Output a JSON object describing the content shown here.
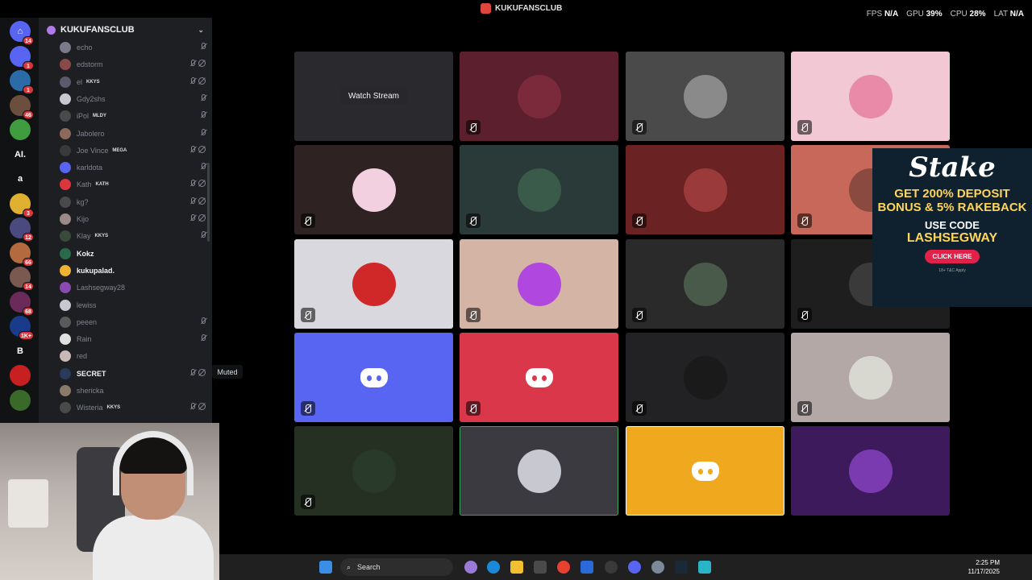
{
  "window": {
    "title": "KUKUFANSCLUB"
  },
  "stats": [
    {
      "label": "FPS",
      "value": "N/A"
    },
    {
      "label": "GPU",
      "value": "39%"
    },
    {
      "label": "CPU",
      "value": "28%"
    },
    {
      "label": "LAT",
      "value": "N/A"
    }
  ],
  "servers": [
    {
      "name": "discord-home",
      "badge": "14",
      "color": "#5865f2",
      "glyph": "⌂"
    },
    {
      "name": "server-2",
      "badge": "1",
      "color": "#5865f2",
      "glyph": ""
    },
    {
      "name": "server-3",
      "badge": "1",
      "color": "#2b6ca8",
      "glyph": ""
    },
    {
      "name": "server-4",
      "badge": "46",
      "color": "#6c4e3e",
      "glyph": ""
    },
    {
      "name": "server-5",
      "badge": "",
      "color": "#3f9d3f",
      "glyph": ""
    },
    {
      "name": "server-ai",
      "badge": "",
      "color": "#111214",
      "glyph": "AI."
    },
    {
      "name": "server-a",
      "badge": "",
      "color": "#111214",
      "glyph": "a"
    },
    {
      "name": "server-8",
      "badge": "3",
      "color": "#e0b030",
      "glyph": ""
    },
    {
      "name": "server-9",
      "badge": "12",
      "color": "#4a4a80",
      "glyph": ""
    },
    {
      "name": "server-10",
      "badge": "66",
      "color": "#b26a3e",
      "glyph": ""
    },
    {
      "name": "server-11",
      "badge": "14",
      "color": "#7a5a50",
      "glyph": ""
    },
    {
      "name": "server-12",
      "badge": "68",
      "color": "#6a2a5a",
      "glyph": ""
    },
    {
      "name": "server-13",
      "badge": "1K+",
      "color": "#1a3a8a",
      "glyph": ""
    },
    {
      "name": "server-b",
      "badge": "",
      "color": "#111214",
      "glyph": "B"
    },
    {
      "name": "server-15",
      "badge": "",
      "color": "#c82020",
      "glyph": ""
    },
    {
      "name": "server-16",
      "badge": "",
      "color": "#3a6a2a",
      "glyph": ""
    }
  ],
  "sidebar": {
    "server_name": "KUKUFANSCLUB"
  },
  "members": [
    {
      "name": "echo",
      "tag": "",
      "bright": false,
      "color": "#7a7a8a",
      "icons": 1
    },
    {
      "name": "edstorm",
      "tag": "",
      "bright": false,
      "color": "#8a4a4a",
      "icons": 2
    },
    {
      "name": "el",
      "tag": "KKYS",
      "bright": false,
      "color": "#5a5a6a",
      "icons": 2
    },
    {
      "name": "Gdy2shs",
      "tag": "",
      "bright": false,
      "color": "#c8c8d0",
      "icons": 1
    },
    {
      "name": "iPol",
      "tag": "MLDY",
      "bright": false,
      "color": "#4a4a4a",
      "icons": 1
    },
    {
      "name": "Jabolero",
      "tag": "",
      "bright": false,
      "color": "#8a6a5a",
      "icons": 1
    },
    {
      "name": "Joe Vince",
      "tag": "MEGA",
      "bright": false,
      "color": "#3a3a3a",
      "icons": 2
    },
    {
      "name": "karldota",
      "tag": "",
      "bright": false,
      "color": "#5865f2",
      "icons": 1
    },
    {
      "name": "Kath",
      "tag": "KATH",
      "bright": false,
      "color": "#da373c",
      "icons": 2
    },
    {
      "name": "kg?",
      "tag": "",
      "bright": false,
      "color": "#4a4a4a",
      "icons": 2
    },
    {
      "name": "Kijo",
      "tag": "",
      "bright": false,
      "color": "#9a8a8a",
      "icons": 2
    },
    {
      "name": "Klay",
      "tag": "KKYS",
      "bright": false,
      "color": "#3a4a3a",
      "icons": 1
    },
    {
      "name": "Kokz",
      "tag": "",
      "bright": true,
      "color": "#2a6a4a",
      "icons": 0
    },
    {
      "name": "kukupalad.",
      "tag": "",
      "bright": true,
      "color": "#f0b232",
      "icons": 0
    },
    {
      "name": "Lashsegway28",
      "tag": "",
      "bright": false,
      "color": "#8a4ab0",
      "icons": 0
    },
    {
      "name": "lewiss",
      "tag": "",
      "bright": false,
      "color": "#c8c8d0",
      "icons": 0
    },
    {
      "name": "peeen",
      "tag": "",
      "bright": false,
      "color": "#5a5a5a",
      "icons": 1
    },
    {
      "name": "Rain",
      "tag": "",
      "bright": false,
      "color": "#e0e0e0",
      "icons": 1
    },
    {
      "name": "red",
      "tag": "",
      "bright": false,
      "color": "#c8b8b8",
      "icons": 0
    },
    {
      "name": "SECRET",
      "tag": "",
      "bright": true,
      "color": "#2a3a5a",
      "icons": 2
    },
    {
      "name": "shericka",
      "tag": "",
      "bright": false,
      "color": "#8a7a6a",
      "icons": 0
    },
    {
      "name": "Wisteria",
      "tag": "KKYS",
      "bright": false,
      "color": "#4a4a4a",
      "icons": 2
    }
  ],
  "tooltip": "Muted",
  "watch_stream_label": "Watch Stream",
  "tiles": [
    {
      "bg": "#2a2a2e",
      "kind": "stream",
      "muted": false,
      "avatar": ""
    },
    {
      "bg": "#5c1f2e",
      "kind": "avatar",
      "muted": true,
      "avatar": "#7a2a3a"
    },
    {
      "bg": "#4a4a4a",
      "kind": "avatar",
      "muted": true,
      "avatar": "#8a8a8a"
    },
    {
      "bg": "#f2c8d4",
      "kind": "avatar",
      "muted": true,
      "avatar": "#e88aa8"
    },
    {
      "bg": "#2e2222",
      "kind": "avatar",
      "muted": true,
      "avatar": "#f2d0e0"
    },
    {
      "bg": "#2a3a38",
      "kind": "avatar",
      "muted": true,
      "avatar": "#3a5a4a"
    },
    {
      "bg": "#6a2222",
      "kind": "avatar",
      "muted": true,
      "avatar": "#9a3a3a"
    },
    {
      "bg": "#c8685a",
      "kind": "avatar",
      "muted": true,
      "avatar": "#8a4a40"
    },
    {
      "bg": "#d8d8de",
      "kind": "avatar",
      "muted": true,
      "avatar": "#d02828"
    },
    {
      "bg": "#d4b4a4",
      "kind": "avatar",
      "muted": true,
      "avatar": "#b048e0"
    },
    {
      "bg": "#2a2a2a",
      "kind": "avatar",
      "muted": true,
      "avatar": "#4a5a4a"
    },
    {
      "bg": "#1e1e1e",
      "kind": "avatar",
      "muted": true,
      "avatar": "#3a3a3a"
    },
    {
      "bg": "#5865f2",
      "kind": "discord",
      "muted": true,
      "avatar": ""
    },
    {
      "bg": "#da374a",
      "kind": "discord",
      "muted": true,
      "avatar": ""
    },
    {
      "bg": "#222224",
      "kind": "avatar",
      "muted": true,
      "avatar": "#1a1a1a"
    },
    {
      "bg": "#b4a8a6",
      "kind": "avatar",
      "muted": true,
      "avatar": "#d8d8d0"
    },
    {
      "bg": "#263022",
      "kind": "avatar",
      "muted": true,
      "avatar": "#2a3a2a"
    },
    {
      "bg": "#3a3a40",
      "kind": "avatar",
      "muted": false,
      "avatar": "#c8c8d0"
    },
    {
      "bg": "#f0a81e",
      "kind": "discord",
      "muted": false,
      "avatar": ""
    },
    {
      "bg": "#3c1a5c",
      "kind": "avatar",
      "muted": false,
      "avatar": "#7a3ab0"
    }
  ],
  "ad": {
    "brand": "Stake",
    "line1": "GET 200% DEPOSIT BONUS & 5% RAKEBACK",
    "line2": "USE CODE",
    "code": "LASHSEGWAY",
    "cta": "CLICK HERE",
    "fine": "18+ T&C Apply"
  },
  "taskbar": {
    "search_label": "Search",
    "time": "2:25 PM",
    "date": "11/17/2025"
  }
}
